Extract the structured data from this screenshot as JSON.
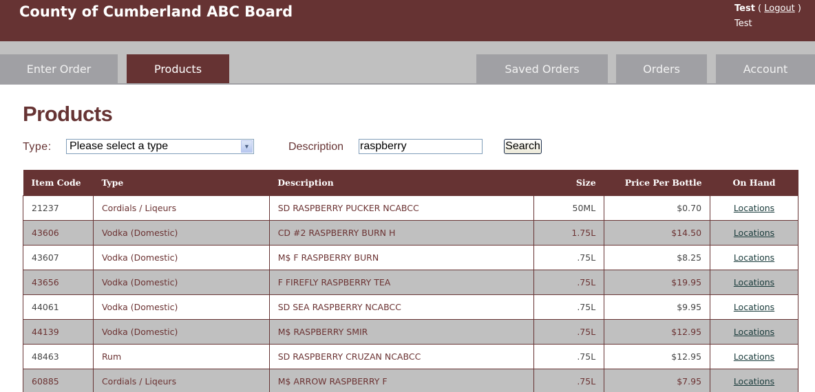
{
  "header": {
    "title": "County of Cumberland ABC Board",
    "user_name": "Test",
    "logout_label": "Logout",
    "account_name": "Test"
  },
  "nav": {
    "tabs": [
      {
        "label": "Enter Order",
        "active": false
      },
      {
        "label": "Products",
        "active": true
      },
      {
        "label": "Saved Orders",
        "active": false
      },
      {
        "label": "Orders",
        "active": false
      },
      {
        "label": "Account",
        "active": false
      }
    ]
  },
  "page": {
    "title": "Products"
  },
  "filters": {
    "type_label": "Type:",
    "type_selected": "Please select a type",
    "description_label": "Description",
    "description_value": "raspberry",
    "search_label": "Search"
  },
  "table": {
    "columns": [
      "Item Code",
      "Type",
      "Description",
      "Size",
      "Price Per Bottle",
      "On Hand"
    ],
    "rows": [
      {
        "code": "21237",
        "type": "Cordials / Liqeurs",
        "description": "SD RASPBERRY PUCKER NCABCC",
        "size": "50ML",
        "price": "$0.70",
        "on_hand": "Locations"
      },
      {
        "code": "43606",
        "type": "Vodka (Domestic)",
        "description": "CD #2 RASPBERRY BURN H",
        "size": "1.75L",
        "price": "$14.50",
        "on_hand": "Locations"
      },
      {
        "code": "43607",
        "type": "Vodka (Domestic)",
        "description": "M$ F RASPBERRY BURN",
        "size": ".75L",
        "price": "$8.25",
        "on_hand": "Locations"
      },
      {
        "code": "43656",
        "type": "Vodka (Domestic)",
        "description": "F FIREFLY RASPBERRY TEA",
        "size": ".75L",
        "price": "$19.95",
        "on_hand": "Locations"
      },
      {
        "code": "44061",
        "type": "Vodka (Domestic)",
        "description": "SD SEA RASPBERRY NCABCC",
        "size": ".75L",
        "price": "$9.95",
        "on_hand": "Locations"
      },
      {
        "code": "44139",
        "type": "Vodka (Domestic)",
        "description": "M$ RASPBERRY SMIR",
        "size": ".75L",
        "price": "$12.95",
        "on_hand": "Locations"
      },
      {
        "code": "48463",
        "type": "Rum",
        "description": "SD RASPBERRY CRUZAN NCABCC",
        "size": ".75L",
        "price": "$12.95",
        "on_hand": "Locations"
      },
      {
        "code": "60885",
        "type": "Cordials / Liqeurs",
        "description": "M$ ARROW RASPBERRY F",
        "size": ".75L",
        "price": "$7.95",
        "on_hand": "Locations"
      }
    ]
  },
  "colors": {
    "brand": "#663333",
    "nav_bg": "#c0c0c0",
    "tab_inactive": "#a0a0a4",
    "row_alt": "#c0c0c0"
  }
}
